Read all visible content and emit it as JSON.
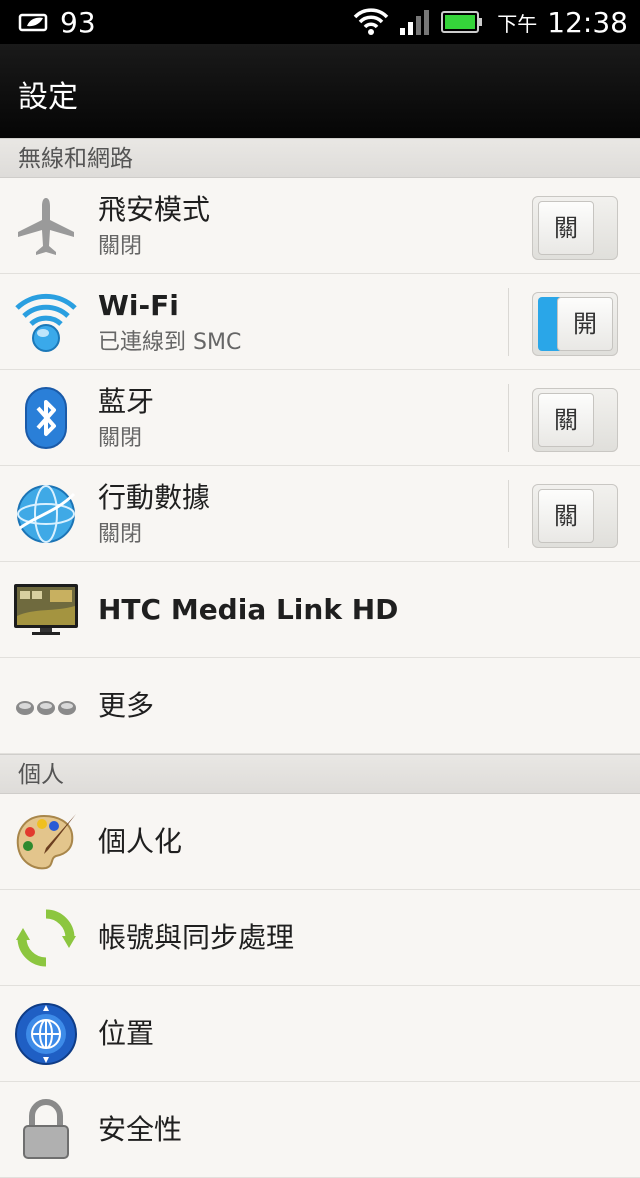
{
  "status_bar": {
    "notification_count": "93",
    "time_period": "下午",
    "time": "12:38"
  },
  "action_bar": {
    "title": "設定"
  },
  "sections": {
    "wireless": {
      "header": "無線和網路",
      "airplane": {
        "label": "飛安模式",
        "status": "關閉",
        "toggle": "關",
        "on": false
      },
      "wifi": {
        "label": "Wi-Fi",
        "status": "已連線到 SMC",
        "toggle": "開",
        "on": true
      },
      "bluetooth": {
        "label": "藍牙",
        "status": "關閉",
        "toggle": "關",
        "on": false
      },
      "mobile_data": {
        "label": "行動數據",
        "status": "關閉",
        "toggle": "關",
        "on": false
      },
      "media_link": {
        "label": "HTC Media Link HD"
      },
      "more": {
        "label": "更多"
      }
    },
    "personal": {
      "header": "個人",
      "personalize": {
        "label": "個人化"
      },
      "accounts_sync": {
        "label": "帳號與同步處理"
      },
      "location": {
        "label": "位置"
      },
      "security": {
        "label": "安全性"
      }
    }
  },
  "colors": {
    "accent": "#2aa6e8",
    "battery": "#35d43a",
    "status_bar": "#000000"
  },
  "icons": {
    "status_left": "notification-leaf-icon",
    "status_right": [
      "wifi-signal-icon",
      "cell-signal-icon",
      "battery-icon"
    ],
    "rows": [
      "airplane-icon",
      "wifi-icon",
      "bluetooth-icon",
      "globe-data-icon",
      "tv-monitor-icon",
      "more-dots-icon",
      "palette-icon",
      "sync-arrows-icon",
      "location-compass-icon",
      "lock-icon"
    ]
  }
}
